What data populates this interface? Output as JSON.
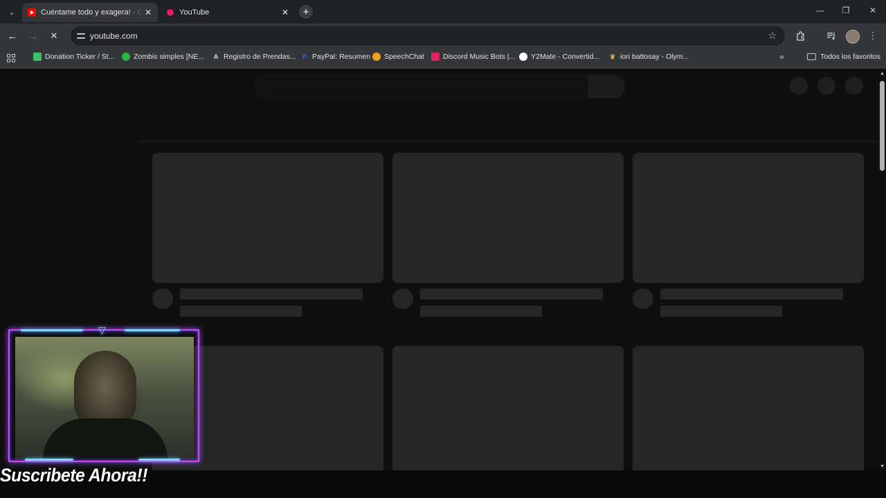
{
  "browser": {
    "tabs": [
      {
        "title": "Cuéntame todo y exagera! - Qu",
        "icon": "youtube-icon",
        "active": true
      },
      {
        "title": "YouTube",
        "icon": "youtube-loading-icon",
        "active": false
      }
    ],
    "address": {
      "url": "youtube.com"
    },
    "icons": {
      "back": "←",
      "forward": "→",
      "stop": "✕",
      "star": "☆",
      "extensions": "puzzle-icon",
      "media": "media-icon",
      "menu": "⋮",
      "new_tab": "+",
      "minimize": "—",
      "restore": "❐",
      "close": "✕",
      "tab_search": "⌄"
    }
  },
  "bookmarks": {
    "items": [
      {
        "label": "Donation Ticker / St...",
        "icon": "streamlabs-icon",
        "color": "#3fbf64"
      },
      {
        "label": "Zombis simples [NE...",
        "icon": "green-circle-icon",
        "color": "#29b34b"
      },
      {
        "label": "Registro de Prendas...",
        "icon": "a-letter-icon",
        "color": "#35363a"
      },
      {
        "label": "PayPal: Resumen",
        "icon": "paypal-icon",
        "color": "#2a6edb"
      },
      {
        "label": "SpeechChat",
        "icon": "speechchat-icon",
        "color": "#f0a020"
      },
      {
        "label": "Discord Music Bots |...",
        "icon": "discord-bots-icon",
        "color": "#e0245e"
      },
      {
        "label": "Y2Mate - Convertid...",
        "icon": "y2mate-icon",
        "color": "#ffffff"
      },
      {
        "label": "iori battosay - Olym...",
        "icon": "crown-icon",
        "color": "#e0b040"
      }
    ],
    "more": "»",
    "all_favorites": "Todos los favoritos"
  },
  "overlay": {
    "subscribe_text": "Suscribete Ahora!!",
    "frame_color": "#c84cf0",
    "accent_color": "#6fd2ff"
  }
}
